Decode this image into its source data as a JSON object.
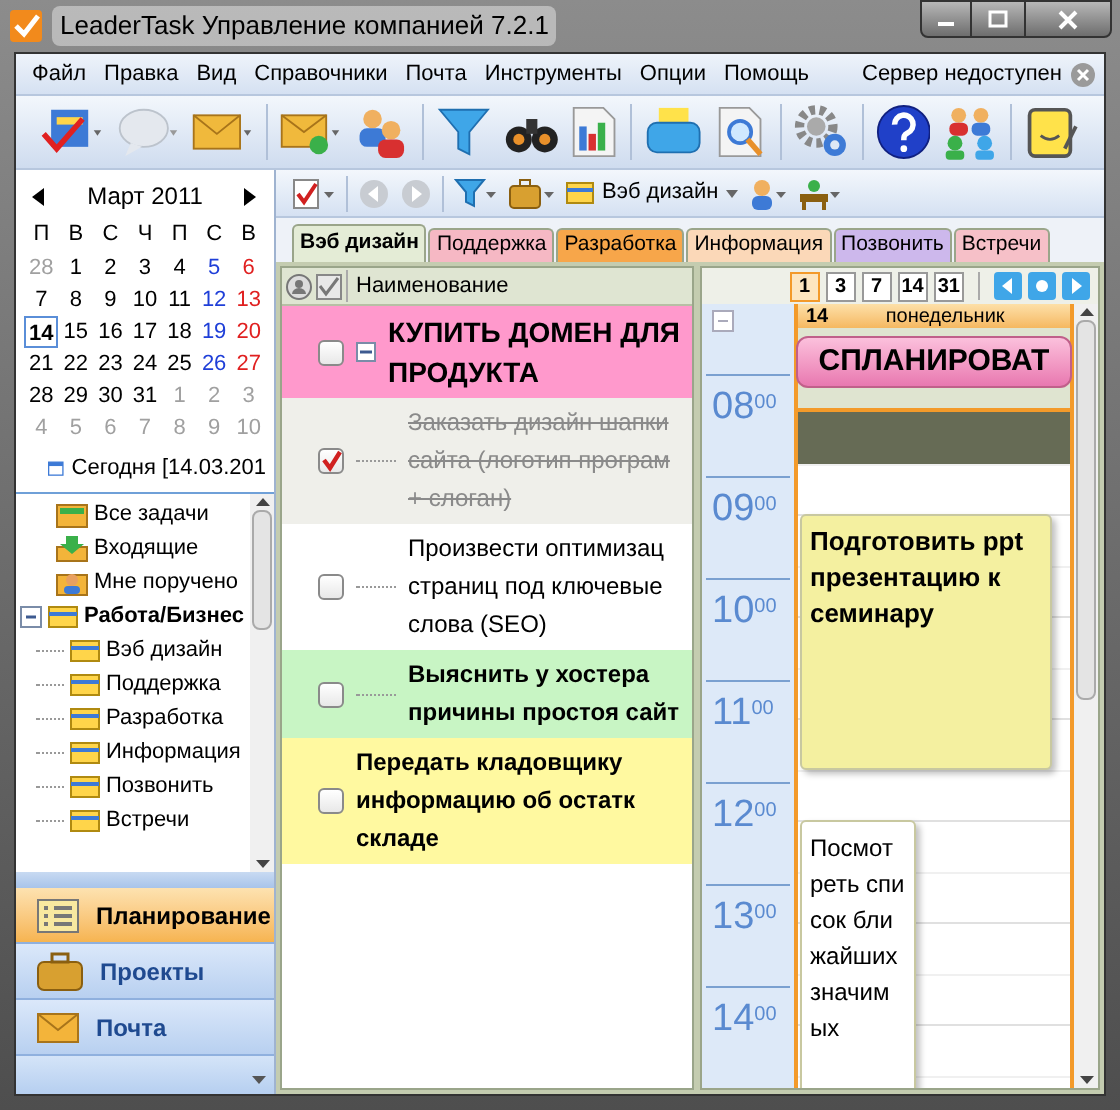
{
  "window": {
    "title": "LeaderTask Управление компанией 7.2.1"
  },
  "menu": [
    "Файл",
    "Правка",
    "Вид",
    "Справочники",
    "Почта",
    "Инструменты",
    "Опции",
    "Помощь"
  ],
  "server_status": "Сервер недоступен",
  "filter_folder": "Вэб дизайн",
  "calendar": {
    "month": "Март 2011",
    "weekdays": [
      "П",
      "В",
      "С",
      "Ч",
      "П",
      "С",
      "В"
    ],
    "weeks": [
      [
        {
          "day": "28",
          "outside": true,
          "selected": false
        },
        {
          "day": "1",
          "outside": false,
          "selected": false
        },
        {
          "day": "2",
          "outside": false,
          "selected": false
        },
        {
          "day": "3",
          "outside": false,
          "selected": false
        },
        {
          "day": "4",
          "outside": false,
          "selected": false
        },
        {
          "day": "5",
          "outside": false,
          "selected": false
        },
        {
          "day": "6",
          "outside": false,
          "selected": false
        }
      ],
      [
        {
          "day": "7",
          "outside": false,
          "selected": false
        },
        {
          "day": "8",
          "outside": false,
          "selected": false
        },
        {
          "day": "9",
          "outside": false,
          "selected": false
        },
        {
          "day": "10",
          "outside": false,
          "selected": false
        },
        {
          "day": "11",
          "outside": false,
          "selected": false
        },
        {
          "day": "12",
          "outside": false,
          "selected": false
        },
        {
          "day": "13",
          "outside": false,
          "selected": false
        }
      ],
      [
        {
          "day": "14",
          "outside": false,
          "selected": true
        },
        {
          "day": "15",
          "outside": false,
          "selected": false
        },
        {
          "day": "16",
          "outside": false,
          "selected": false
        },
        {
          "day": "17",
          "outside": false,
          "selected": false
        },
        {
          "day": "18",
          "outside": false,
          "selected": false
        },
        {
          "day": "19",
          "outside": false,
          "selected": false
        },
        {
          "day": "20",
          "outside": false,
          "selected": false
        }
      ],
      [
        {
          "day": "21",
          "outside": false,
          "selected": false
        },
        {
          "day": "22",
          "outside": false,
          "selected": false
        },
        {
          "day": "23",
          "outside": false,
          "selected": false
        },
        {
          "day": "24",
          "outside": false,
          "selected": false
        },
        {
          "day": "25",
          "outside": false,
          "selected": false
        },
        {
          "day": "26",
          "outside": false,
          "selected": false
        },
        {
          "day": "27",
          "outside": false,
          "selected": false
        }
      ],
      [
        {
          "day": "28",
          "outside": false,
          "selected": false
        },
        {
          "day": "29",
          "outside": false,
          "selected": false
        },
        {
          "day": "30",
          "outside": false,
          "selected": false
        },
        {
          "day": "31",
          "outside": false,
          "selected": false
        },
        {
          "day": "1",
          "outside": true,
          "selected": false
        },
        {
          "day": "2",
          "outside": true,
          "selected": false
        },
        {
          "day": "3",
          "outside": true,
          "selected": false
        }
      ],
      [
        {
          "day": "4",
          "outside": true,
          "selected": false
        },
        {
          "day": "5",
          "outside": true,
          "selected": false
        },
        {
          "day": "6",
          "outside": true,
          "selected": false
        },
        {
          "day": "7",
          "outside": true,
          "selected": false
        },
        {
          "day": "8",
          "outside": true,
          "selected": false
        },
        {
          "day": "9",
          "outside": true,
          "selected": false
        },
        {
          "day": "10",
          "outside": true,
          "selected": false
        }
      ]
    ],
    "today_link": "Сегодня [14.03.201"
  },
  "sidebar_tree": [
    {
      "label": "Все задачи",
      "kind": "all"
    },
    {
      "label": "Входящие",
      "kind": "inbox"
    },
    {
      "label": "Мне поручено",
      "kind": "assigned"
    },
    {
      "label": "Работа/Бизнес",
      "kind": "folder",
      "expanded": true,
      "children": [
        {
          "label": "Вэб дизайн",
          "kind": "folder"
        },
        {
          "label": "Поддержка",
          "kind": "folder"
        },
        {
          "label": "Разработка",
          "kind": "folder"
        },
        {
          "label": "Информация",
          "kind": "folder"
        },
        {
          "label": "Позвонить",
          "kind": "folder"
        },
        {
          "label": "Встречи",
          "kind": "folder"
        }
      ]
    }
  ],
  "nav": [
    {
      "label": "Планирование",
      "kind": "planning",
      "selected": true
    },
    {
      "label": "Проекты",
      "kind": "projects",
      "selected": false
    },
    {
      "label": "Почта",
      "kind": "mail",
      "selected": false
    }
  ],
  "tabs": [
    {
      "label": "Вэб дизайн",
      "selected": true,
      "color": "#e4ecd6"
    },
    {
      "label": "Поддержка",
      "selected": false,
      "color": "#f6b8c4"
    },
    {
      "label": "Разработка",
      "selected": false,
      "color": "#f7a64a"
    },
    {
      "label": "Информация",
      "selected": false,
      "color": "#fbd8b8"
    },
    {
      "label": "Позвонить",
      "selected": false,
      "color": "#cdb8ec"
    },
    {
      "label": "Встречи",
      "selected": false,
      "color": "#f6c0c8"
    }
  ],
  "task_list": {
    "column": "Наименование",
    "tasks": [
      {
        "title": "КУПИТЬ ДОМЕН ДЛЯ\nПРОДУКТА",
        "kind": "project",
        "checked": false,
        "color": "#ff99cc",
        "expanded": true,
        "children": [
          {
            "title": "Заказать дизайн шапки\nсайта (логотип програм\n+ слоган)",
            "kind": "task",
            "checked": true,
            "bold": false,
            "color": "#efefea"
          },
          {
            "title": "Произвести оптимизац\nстраниц под ключевые\nслова (SEO)",
            "kind": "task",
            "checked": false,
            "bold": false,
            "color": "#ffffff"
          },
          {
            "title": "Выяснить у хостера\nпричины простоя сайт",
            "kind": "task",
            "checked": false,
            "bold": true,
            "color": "#c8f5c4"
          }
        ]
      },
      {
        "title": "Передать кладовщику\nинформацию об остатк\nскладе",
        "kind": "task",
        "checked": false,
        "bold": true,
        "color": "#fff9a0"
      }
    ]
  },
  "day_view": {
    "view_buttons": [
      {
        "label": "1",
        "selected": true
      },
      {
        "label": "3",
        "selected": false
      },
      {
        "label": "7",
        "selected": false
      },
      {
        "label": "14",
        "selected": false
      },
      {
        "label": "31",
        "selected": false
      }
    ],
    "day_number": "14",
    "weekday": "понедельник",
    "plan_button": "СПЛАНИРОВАТ",
    "hours": [
      "08$^{00}$",
      "09$^{00}$",
      "10$^{00}$",
      "11$^{00}$",
      "12$^{00}$",
      "13$^{00}$",
      "14$^{00}$"
    ],
    "events": [
      {
        "title": "Подготовить ppt презентацию к семинару",
        "kind": "bold",
        "color": "#f4f0a0"
      },
      {
        "title": "Посмотреть список ближайших значимых",
        "kind": "plain",
        "color": "#ffffff"
      }
    ]
  }
}
